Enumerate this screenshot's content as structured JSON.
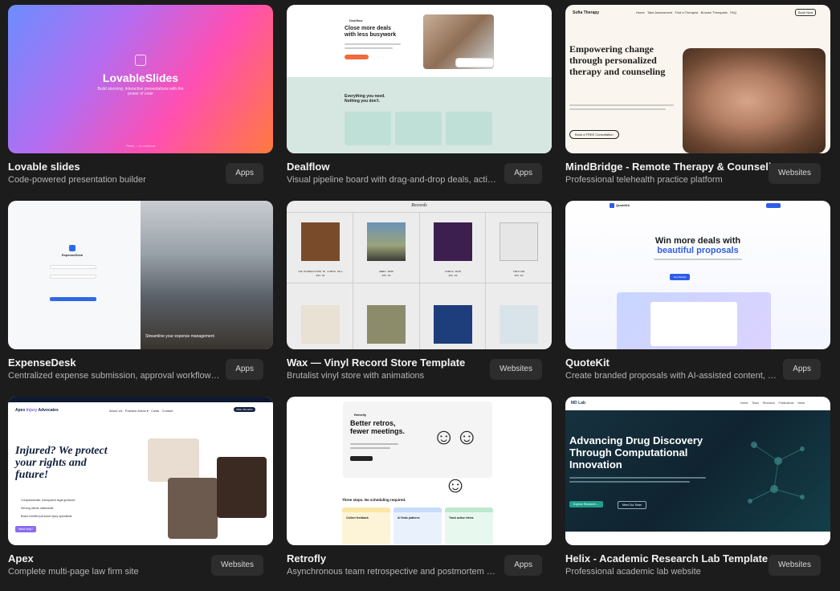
{
  "cards": [
    {
      "title": "Lovable slides",
      "desc": "Code-powered presentation builder",
      "tag": "Apps",
      "thumb": {
        "logo": "LovableSlides",
        "tagline": "Build stunning, interactive presentations with the power of code",
        "footer": "Press → to continue"
      }
    },
    {
      "title": "Dealflow",
      "desc": "Visual pipeline board with drag-and-drop deals, acti…",
      "tag": "Apps",
      "thumb": {
        "brand": "Dealflow",
        "headline": "Close more deals with less busywork",
        "section": "Everything you need. Nothing you don't."
      }
    },
    {
      "title": "MindBridge - Remote Therapy & Counseli…",
      "desc": "Professional telehealth practice platform",
      "tag": "Websites",
      "thumb": {
        "brand": "Sofia Therapy",
        "nav": [
          "Home",
          "Take Assessment",
          "Find a Therapist",
          "Browse Therapists",
          "FAQ"
        ],
        "book": "Book Now",
        "headline": "Empowering change through personalized therapy and counseling",
        "cta": "Book a FREE Consultation"
      }
    },
    {
      "title": "ExpenseDesk",
      "desc": "Centralized expense submission, approval workflow…",
      "tag": "Apps",
      "thumb": {
        "brand": "ExpenseDesk",
        "caption": "Streamline your expense management"
      }
    },
    {
      "title": "Wax — Vinyl Record Store Template",
      "desc": "Brutalist vinyl store with animations",
      "tag": "Websites",
      "thumb": {
        "brand": "Records",
        "items": [
          {
            "name": "THE MISEDUCATION OF LAURYN HILL",
            "price": "$32.00"
          },
          {
            "name": "ABBEY ROAD",
            "price": "$35.00"
          },
          {
            "name": "PURPLE RAIN",
            "price": "$32.00"
          },
          {
            "name": "THRILLER",
            "price": "$35.00"
          }
        ]
      }
    },
    {
      "title": "QuoteKit",
      "desc": "Create branded proposals with AI-assisted content, …",
      "tag": "Apps",
      "thumb": {
        "brand": "QuoteKit",
        "headline1": "Win more deals with",
        "headline2": "beautiful proposals",
        "cta": "Get Started"
      }
    },
    {
      "title": "Apex",
      "desc": "Complete multi-page law firm site",
      "tag": "Websites",
      "thumb": {
        "brand1": "Apex ",
        "brand2": "Injury",
        "brand3": " Advocates",
        "nav": [
          "About Us",
          "Practice Areas ▾",
          "Costs",
          "Contact"
        ],
        "phone": "(555) 789-0200",
        "headline": "Injured? We protect your rights and future!",
        "bullets": [
          "Compassionate, transparent legal guidance",
          "Serving clients nationwide",
          "Board certified personal injury specialists"
        ],
        "cta": "Need help?"
      }
    },
    {
      "title": "Retrofly",
      "desc": "Asynchronous team retrospective and postmortem …",
      "tag": "Apps",
      "thumb": {
        "brand": "Retrofly",
        "headline": "Better retros, fewer meetings.",
        "steps": "Three steps. No scheduling required.",
        "cards": [
          "Collect feedback",
          "AI finds patterns",
          "Track action items"
        ]
      }
    },
    {
      "title": "Helix - Academic Research Lab Template",
      "desc": "Professional academic lab website",
      "tag": "Websites",
      "thumb": {
        "brand": "MD Lab",
        "nav": [
          "Home",
          "Team",
          "Research",
          "Publications",
          "News"
        ],
        "headline": "Advancing Drug Discovery Through Computational Innovation",
        "btn1": "Explore Research →",
        "btn2": "Meet Our Team"
      }
    }
  ]
}
